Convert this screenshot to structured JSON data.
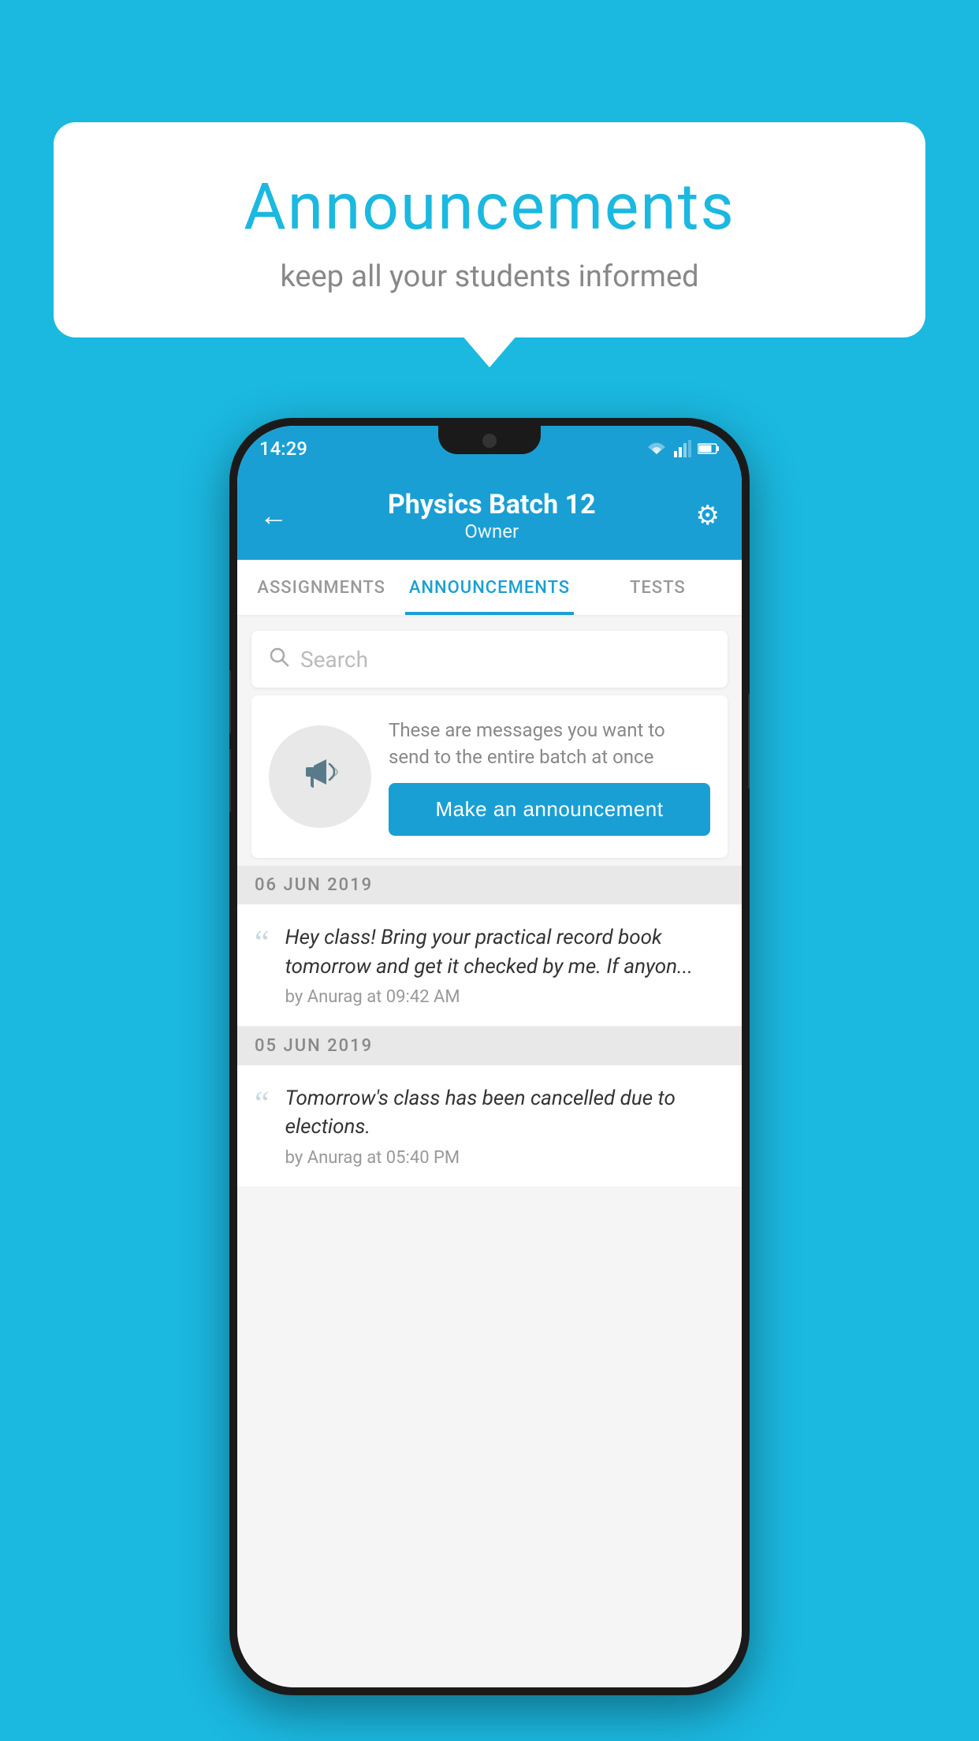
{
  "background_color": "#1BB8E0",
  "speech_bubble": {
    "title": "Announcements",
    "subtitle": "keep all your students informed"
  },
  "phone": {
    "status_bar": {
      "time": "14:29"
    },
    "app_bar": {
      "title": "Physics Batch 12",
      "subtitle": "Owner",
      "back_label": "←",
      "gear_label": "⚙"
    },
    "tabs": [
      {
        "label": "ASSIGNMENTS",
        "active": false
      },
      {
        "label": "ANNOUNCEMENTS",
        "active": true
      },
      {
        "label": "TESTS",
        "active": false
      }
    ],
    "search": {
      "placeholder": "Search"
    },
    "announcement_intro": {
      "description_text": "These are messages you want to send to the entire batch at once",
      "cta_button": "Make an announcement"
    },
    "announcements": [
      {
        "date": "06  JUN  2019",
        "text": "Hey class! Bring your practical record book tomorrow and get it checked by me. If anyon...",
        "meta": "by Anurag at 09:42 AM"
      },
      {
        "date": "05  JUN  2019",
        "text": "Tomorrow's class has been cancelled due to elections.",
        "meta": "by Anurag at 05:40 PM"
      }
    ]
  }
}
